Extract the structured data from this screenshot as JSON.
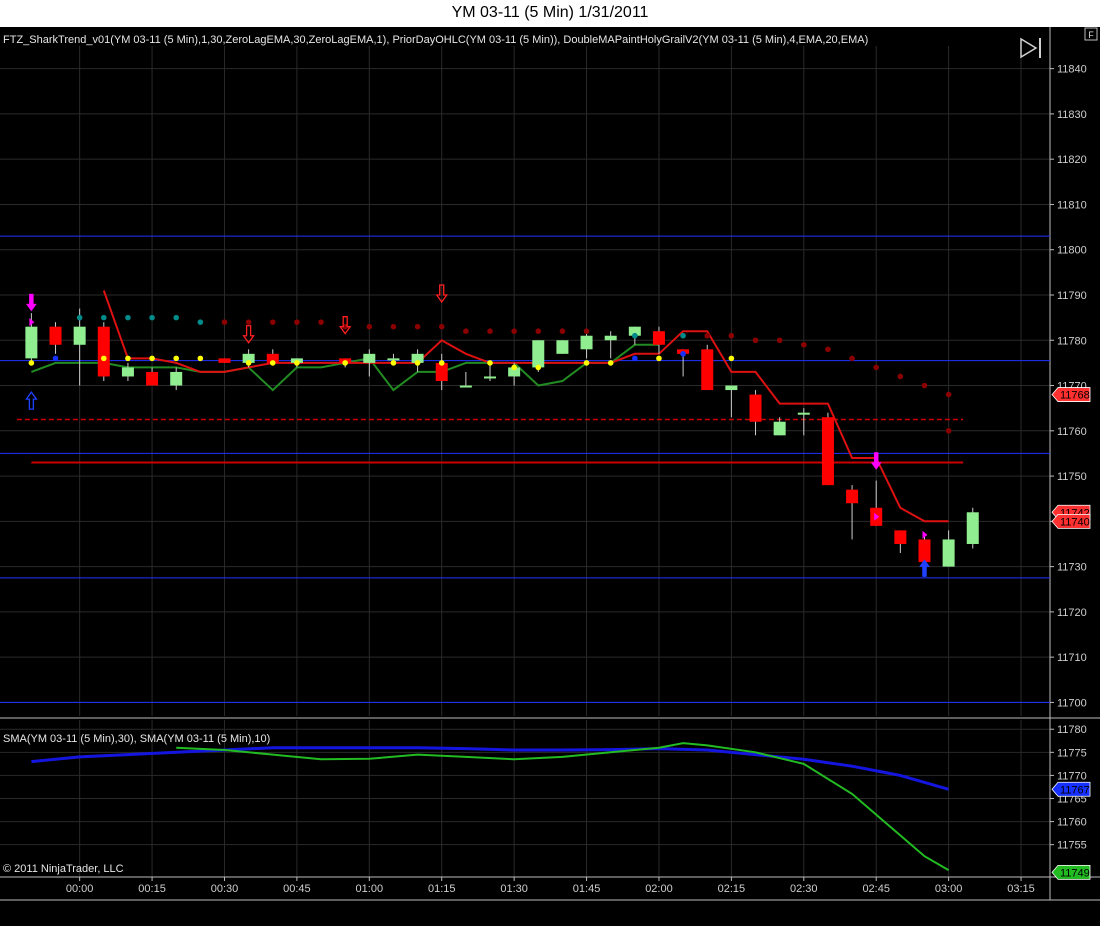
{
  "window": {
    "title": "YM 03-11 (5 Min)  1/31/2011",
    "corner_button": "F"
  },
  "copyright": "© 2011 NinjaTrader, LLC",
  "colors": {
    "background": "#000000",
    "grid": "#2a2a2a",
    "axis_text": "#cfcfcf",
    "bull_candle": "#90ee90",
    "bear_candle": "#ff0000",
    "zero_lag_ema": "#228b22",
    "red_line": "#dd1111",
    "horizontal_blue": "#2233ff",
    "prior_day_line": "#cc0000",
    "dot_dark_red": "#8b0000",
    "dot_yellow": "#ffff00",
    "dot_teal": "#008b8b",
    "sma30": "#1515e0",
    "sma10": "#22bb22"
  },
  "chart_data": [
    {
      "type": "candlestick",
      "indicator_label": "FTZ_SharkTrend_v01(YM 03-11 (5 Min),1,30,ZeroLagEMA,30,ZeroLagEMA,1), PriorDayOHLC(YM 03-11 (5 Min)), DoubleMAPaintHolyGrailV2(YM 03-11 (5 Min),4,EMA,20,EMA)",
      "x_ticks": [
        "00:00",
        "00:15",
        "00:30",
        "00:45",
        "01:00",
        "01:15",
        "01:30",
        "01:45",
        "02:00",
        "02:15",
        "02:30",
        "02:45",
        "03:00",
        "03:15"
      ],
      "x_tick_minutes": [
        0,
        15,
        30,
        45,
        60,
        75,
        90,
        105,
        120,
        135,
        150,
        165,
        180,
        195
      ],
      "xlim_minutes": [
        -16.5,
        201
      ],
      "ylim": [
        11697,
        11845
      ],
      "y_ticks": [
        11700,
        11710,
        11720,
        11730,
        11740,
        11750,
        11760,
        11770,
        11780,
        11790,
        11800,
        11810,
        11820,
        11830,
        11840
      ],
      "candles": [
        {
          "t": -10,
          "o": 11776,
          "h": 11786,
          "l": 11775,
          "c": 11783
        },
        {
          "t": -5,
          "o": 11783,
          "h": 11784,
          "l": 11777,
          "c": 11779
        },
        {
          "t": 0,
          "o": 11779,
          "h": 11787,
          "l": 11770,
          "c": 11783
        },
        {
          "t": 5,
          "o": 11783,
          "h": 11784,
          "l": 11771,
          "c": 11772
        },
        {
          "t": 10,
          "o": 11772,
          "h": 11775,
          "l": 11771,
          "c": 11774
        },
        {
          "t": 15,
          "o": 11773,
          "h": 11774,
          "l": 11770,
          "c": 11770
        },
        {
          "t": 20,
          "o": 11770,
          "h": 11774,
          "l": 11769,
          "c": 11773
        },
        {
          "t": 30,
          "o": 11776,
          "h": 11776,
          "l": 11775,
          "c": 11775
        },
        {
          "t": 35,
          "o": 11775,
          "h": 11778,
          "l": 11774,
          "c": 11777
        },
        {
          "t": 40,
          "o": 11777,
          "h": 11778,
          "l": 11775,
          "c": 11775
        },
        {
          "t": 45,
          "o": 11775,
          "h": 11776,
          "l": 11774,
          "c": 11776
        },
        {
          "t": 55,
          "o": 11776,
          "h": 11776,
          "l": 11774,
          "c": 11775
        },
        {
          "t": 60,
          "o": 11775,
          "h": 11778,
          "l": 11772,
          "c": 11777
        },
        {
          "t": 65,
          "o": 11776,
          "h": 11777,
          "l": 11775,
          "c": 11776
        },
        {
          "t": 70,
          "o": 11775,
          "h": 11778,
          "l": 11773,
          "c": 11777
        },
        {
          "t": 75,
          "o": 11775,
          "h": 11777,
          "l": 11769,
          "c": 11771
        },
        {
          "t": 80,
          "o": 11770,
          "h": 11773,
          "l": 11770,
          "c": 11770
        },
        {
          "t": 85,
          "o": 11772,
          "h": 11775,
          "l": 11771,
          "c": 11772
        },
        {
          "t": 90,
          "o": 11772,
          "h": 11775,
          "l": 11770,
          "c": 11774
        },
        {
          "t": 95,
          "o": 11774,
          "h": 11780,
          "l": 11773,
          "c": 11780
        },
        {
          "t": 100,
          "o": 11777,
          "h": 11780,
          "l": 11777,
          "c": 11780
        },
        {
          "t": 105,
          "o": 11778,
          "h": 11782,
          "l": 11776,
          "c": 11781
        },
        {
          "t": 110,
          "o": 11780,
          "h": 11782,
          "l": 11776,
          "c": 11781
        },
        {
          "t": 115,
          "o": 11781,
          "h": 11783,
          "l": 11779,
          "c": 11783
        },
        {
          "t": 120,
          "o": 11782,
          "h": 11783,
          "l": 11777,
          "c": 11779
        },
        {
          "t": 125,
          "o": 11778,
          "h": 11778,
          "l": 11772,
          "c": 11777
        },
        {
          "t": 130,
          "o": 11778,
          "h": 11779,
          "l": 11769,
          "c": 11769
        },
        {
          "t": 135,
          "o": 11769,
          "h": 11770,
          "l": 11763,
          "c": 11770
        },
        {
          "t": 140,
          "o": 11768,
          "h": 11769,
          "l": 11759,
          "c": 11762
        },
        {
          "t": 145,
          "o": 11759,
          "h": 11763,
          "l": 11759,
          "c": 11762
        },
        {
          "t": 150,
          "o": 11764,
          "h": 11765,
          "l": 11759,
          "c": 11764
        },
        {
          "t": 155,
          "o": 11763,
          "h": 11764,
          "l": 11748,
          "c": 11748
        },
        {
          "t": 160,
          "o": 11747,
          "h": 11748,
          "l": 11736,
          "c": 11744
        },
        {
          "t": 165,
          "o": 11743,
          "h": 11749,
          "l": 11739,
          "c": 11739
        },
        {
          "t": 170,
          "o": 11738,
          "h": 11738,
          "l": 11733,
          "c": 11735
        },
        {
          "t": 175,
          "o": 11736,
          "h": 11737,
          "l": 11731,
          "c": 11731
        },
        {
          "t": 180,
          "o": 11730,
          "h": 11738,
          "l": 11730,
          "c": 11736
        },
        {
          "t": 185,
          "o": 11735,
          "h": 11743,
          "l": 11734,
          "c": 11742
        }
      ],
      "zero_lag_ema_line": [
        [
          -10,
          11773
        ],
        [
          -5,
          11775
        ],
        [
          0,
          11775
        ],
        [
          5,
          11775
        ],
        [
          10,
          11774
        ],
        [
          15,
          11774
        ],
        [
          20,
          11774
        ],
        [
          25,
          11773
        ],
        [
          30,
          11773
        ],
        [
          35,
          11774
        ],
        [
          40,
          11769
        ],
        [
          45,
          11774
        ],
        [
          50,
          11774
        ],
        [
          55,
          11775
        ],
        [
          60,
          11776
        ],
        [
          65,
          11769
        ],
        [
          70,
          11773
        ],
        [
          75,
          11773
        ],
        [
          80,
          11775
        ],
        [
          85,
          11775
        ],
        [
          90,
          11775
        ],
        [
          95,
          11770
        ],
        [
          100,
          11771
        ],
        [
          105,
          11775
        ],
        [
          110,
          11775
        ],
        [
          115,
          11779
        ],
        [
          120,
          11779
        ]
      ],
      "red_line": [
        [
          5,
          11791
        ],
        [
          10,
          11776
        ],
        [
          15,
          11776
        ],
        [
          20,
          11775
        ],
        [
          25,
          11773
        ],
        [
          30,
          11773
        ],
        [
          35,
          11774
        ],
        [
          40,
          11775
        ],
        [
          45,
          11775
        ],
        [
          50,
          11775
        ],
        [
          55,
          11775
        ],
        [
          60,
          11775
        ],
        [
          65,
          11775
        ],
        [
          70,
          11775
        ],
        [
          75,
          11780
        ],
        [
          80,
          11777
        ],
        [
          85,
          11775
        ],
        [
          90,
          11775
        ],
        [
          95,
          11775
        ],
        [
          100,
          11775
        ],
        [
          105,
          11775
        ],
        [
          110,
          11775
        ],
        [
          115,
          11777
        ],
        [
          120,
          11777
        ],
        [
          125,
          11782
        ],
        [
          130,
          11782
        ],
        [
          135,
          11773
        ],
        [
          140,
          11773
        ],
        [
          145,
          11766
        ],
        [
          150,
          11766
        ],
        [
          155,
          11766
        ],
        [
          160,
          11754
        ],
        [
          165,
          11754
        ],
        [
          170,
          11743
        ],
        [
          175,
          11740
        ],
        [
          180,
          11740
        ]
      ],
      "dots_dark_red": [
        [
          30,
          11784
        ],
        [
          35,
          11784
        ],
        [
          40,
          11784
        ],
        [
          45,
          11784
        ],
        [
          50,
          11784
        ],
        [
          55,
          11783
        ],
        [
          60,
          11783
        ],
        [
          65,
          11783
        ],
        [
          70,
          11783
        ],
        [
          75,
          11783
        ],
        [
          80,
          11782
        ],
        [
          85,
          11782
        ],
        [
          90,
          11782
        ],
        [
          95,
          11782
        ],
        [
          100,
          11782
        ],
        [
          105,
          11782
        ],
        [
          130,
          11781
        ],
        [
          135,
          11781
        ],
        [
          140,
          11780
        ],
        [
          145,
          11780
        ],
        [
          150,
          11779
        ],
        [
          155,
          11778
        ],
        [
          160,
          11776
        ],
        [
          165,
          11774
        ],
        [
          170,
          11772
        ],
        [
          175,
          11770
        ],
        [
          180,
          11768
        ],
        [
          180,
          11760
        ]
      ],
      "dots_teal": [
        [
          0,
          11785
        ],
        [
          5,
          11785
        ],
        [
          10,
          11785
        ],
        [
          15,
          11785
        ],
        [
          20,
          11785
        ],
        [
          25,
          11784
        ],
        [
          115,
          11781
        ],
        [
          125,
          11781
        ]
      ],
      "dots_yellow": [
        [
          -10,
          11775
        ],
        [
          5,
          11776
        ],
        [
          10,
          11776
        ],
        [
          15,
          11776
        ],
        [
          20,
          11776
        ],
        [
          25,
          11776
        ],
        [
          35,
          11775
        ],
        [
          40,
          11775
        ],
        [
          45,
          11775
        ],
        [
          55,
          11775
        ],
        [
          65,
          11775
        ],
        [
          70,
          11775
        ],
        [
          75,
          11775
        ],
        [
          85,
          11775
        ],
        [
          90,
          11774
        ],
        [
          95,
          11774
        ],
        [
          105,
          11775
        ],
        [
          110,
          11775
        ],
        [
          120,
          11776
        ],
        [
          135,
          11776
        ]
      ],
      "dots_blue": [
        [
          -5,
          11776
        ],
        [
          115,
          11776
        ],
        [
          125,
          11777
        ]
      ],
      "blue_horizontal_lines": [
        11803,
        11775.5,
        11755,
        11727.5,
        11700
      ],
      "prior_day_dashed": {
        "y": 11762.5,
        "from": -13,
        "to": 183
      },
      "prior_day_solid": {
        "y": 11753,
        "from": -10,
        "to": 183
      },
      "arrows_magenta_down": [
        [
          -10,
          11788
        ],
        [
          165,
          11753
        ]
      ],
      "arrows_red_down": [
        [
          35,
          11781
        ],
        [
          55,
          11783
        ],
        [
          75,
          11790
        ]
      ],
      "arrows_blue_up": [
        [
          -10,
          11767
        ],
        [
          175,
          11730
        ]
      ],
      "magenta_markers": [
        [
          -10,
          11784
        ],
        [
          165,
          11741
        ],
        [
          175,
          11737
        ]
      ],
      "price_markers": [
        {
          "label": "11768",
          "y": 11768,
          "color": "#ff3030"
        },
        {
          "label": "11742",
          "y": 11742,
          "color": "#ff3030"
        },
        {
          "label": "11740",
          "y": 11740,
          "color": "#ff3030"
        }
      ]
    },
    {
      "type": "line",
      "indicator_label": "SMA(YM 03-11 (5 Min),30), SMA(YM 03-11 (5 Min),10)",
      "ylim": [
        11748,
        11782
      ],
      "y_ticks": [
        11755,
        11760,
        11765,
        11770,
        11775,
        11780
      ],
      "series": [
        {
          "key": "sma30",
          "points": [
            [
              -10,
              11773
            ],
            [
              0,
              11774
            ],
            [
              10,
              11774.5
            ],
            [
              20,
              11775
            ],
            [
              30,
              11775.5
            ],
            [
              40,
              11776
            ],
            [
              50,
              11776
            ],
            [
              60,
              11776
            ],
            [
              70,
              11776
            ],
            [
              80,
              11775.8
            ],
            [
              90,
              11775.5
            ],
            [
              100,
              11775.5
            ],
            [
              110,
              11775.6
            ],
            [
              120,
              11775.8
            ],
            [
              130,
              11775.5
            ],
            [
              140,
              11774.5
            ],
            [
              150,
              11773.5
            ],
            [
              160,
              11772
            ],
            [
              170,
              11770
            ],
            [
              180,
              11767
            ]
          ]
        },
        {
          "key": "sma10",
          "points": [
            [
              20,
              11776
            ],
            [
              30,
              11775.5
            ],
            [
              40,
              11774.5
            ],
            [
              50,
              11773.5
            ],
            [
              60,
              11773.6
            ],
            [
              70,
              11774.5
            ],
            [
              80,
              11774
            ],
            [
              90,
              11773.5
            ],
            [
              100,
              11774
            ],
            [
              110,
              11775
            ],
            [
              120,
              11776
            ],
            [
              125,
              11777
            ],
            [
              130,
              11776.5
            ],
            [
              140,
              11775
            ],
            [
              150,
              11772.5
            ],
            [
              160,
              11766
            ],
            [
              170,
              11757
            ],
            [
              175,
              11752.5
            ],
            [
              180,
              11749.5
            ]
          ]
        }
      ],
      "price_markers": [
        {
          "label": "11767",
          "y": 11767,
          "color": "#1530ff"
        },
        {
          "label": "11749",
          "y": 11749,
          "color": "#22bb22"
        }
      ]
    }
  ]
}
